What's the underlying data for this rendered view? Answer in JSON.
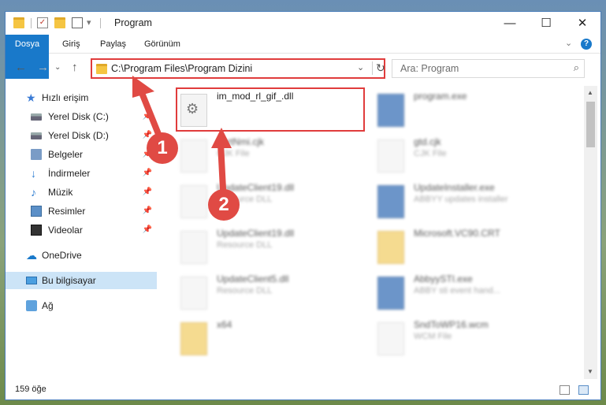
{
  "window": {
    "title": "Program",
    "controls": {
      "minimize": "—",
      "maximize": "☐",
      "close": "✕"
    }
  },
  "ribbon": {
    "tabs": [
      "Dosya",
      "Giriş",
      "Paylaş",
      "Görünüm"
    ],
    "help": "?"
  },
  "nav": {
    "address": "C:\\Program Files\\Program Dizini",
    "search_placeholder": "Ara: Program"
  },
  "sidebar": {
    "items": [
      {
        "label": "Hızlı erişim",
        "icon": "star-icon"
      },
      {
        "label": "Yerel Disk (C:)",
        "icon": "disk-icon",
        "pinned": true
      },
      {
        "label": "Yerel Disk (D:)",
        "icon": "disk-icon",
        "pinned": true
      },
      {
        "label": "Belgeler",
        "icon": "documents-icon",
        "pinned": true
      },
      {
        "label": "İndirmeler",
        "icon": "download-icon",
        "pinned": true
      },
      {
        "label": "Müzik",
        "icon": "music-icon",
        "pinned": true
      },
      {
        "label": "Resimler",
        "icon": "pictures-icon",
        "pinned": true
      },
      {
        "label": "Videolar",
        "icon": "videos-icon",
        "pinned": true
      },
      {
        "label": "OneDrive",
        "icon": "cloud-icon"
      },
      {
        "label": "Bu bilgisayar",
        "icon": "computer-icon",
        "selected": true
      },
      {
        "label": "Ağ",
        "icon": "network-icon"
      }
    ]
  },
  "files": [
    {
      "name": "im_mod_rl_gif_.dll",
      "type": "",
      "kind": "dll",
      "highlighted": true
    },
    {
      "name": "program.exe",
      "type": "",
      "kind": "exe"
    },
    {
      "name": "partNmi.cjk",
      "type": "CJK File",
      "kind": "doc"
    },
    {
      "name": "gtd.cjk",
      "type": "CJK File",
      "kind": "doc"
    },
    {
      "name": "UpdateClient19.dll",
      "type": "Resource DLL",
      "kind": "dll"
    },
    {
      "name": "UpdateInstaller.exe",
      "type": "ABBYY updates installer",
      "kind": "exe"
    },
    {
      "name": "UpdateClient19.dll",
      "type": "Resource DLL",
      "kind": "dll"
    },
    {
      "name": "Microsoft.VC90.CRT",
      "type": "",
      "kind": "folder"
    },
    {
      "name": "UpdateClient5.dll",
      "type": "Resource DLL",
      "kind": "dll"
    },
    {
      "name": "AbbyySTI.exe",
      "type": "ABBY sti event hand...",
      "kind": "exe"
    },
    {
      "name": "x64",
      "type": "",
      "kind": "folder"
    },
    {
      "name": "SndToWP16.wcm",
      "type": "WCM File",
      "kind": "doc"
    }
  ],
  "status": {
    "count": "159 öğe"
  },
  "annotations": {
    "step1": "1",
    "step2": "2"
  },
  "colors": {
    "accent": "#1979ca",
    "highlight": "#e03c3c",
    "badge": "#e04a44",
    "selected": "#cce4f7"
  }
}
